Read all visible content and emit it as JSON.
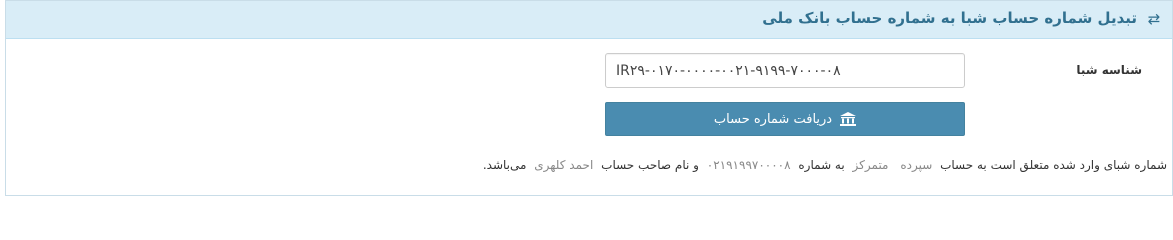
{
  "header": {
    "title": "تبدیل شماره حساب شبا به شماره حساب بانک ملی",
    "icon": "exchange-arrows-icon"
  },
  "form": {
    "iban_label": "شناسه شبا",
    "iban_value": "IR۲۹-۰۱۷۰-۰۰۰۰-۰۰۲۱-۹۱۹۹-۷۰۰۰-۰۸",
    "submit_label": "دریافت شماره حساب",
    "submit_icon": "bank-icon"
  },
  "result": {
    "text_1": "شماره شبای وارد شده متعلق است به حساب",
    "account_type": "سپرده",
    "account_kind": "متمرکز",
    "text_2": "به شماره",
    "account_number": "۰۲۱۹۱۹۹۷۰۰۰۰۸",
    "text_3": "و نام صاحب حساب",
    "owner_name": "احمد کلهری",
    "text_4": "می‌باشد."
  },
  "colors": {
    "header_bg": "#d9edf7",
    "header_text": "#31708f",
    "button_bg": "#4a8cb0"
  }
}
